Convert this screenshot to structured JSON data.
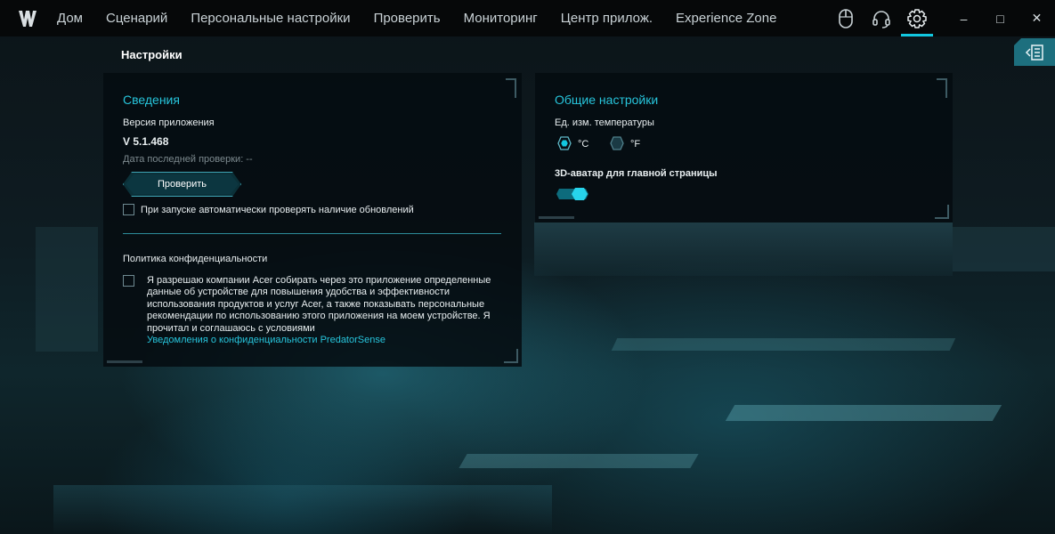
{
  "titlebar": {
    "nav": [
      "Дом",
      "Сценарий",
      "Персональные настройки",
      "Проверить",
      "Мониторинг",
      "Центр прилож.",
      "Experience Zone"
    ],
    "window_controls": {
      "minimize": "–",
      "maximize": "□",
      "close": "✕"
    }
  },
  "page": {
    "title": "Настройки"
  },
  "info": {
    "title": "Сведения",
    "version_label": "Версия приложения",
    "version_value": "V 5.1.468",
    "last_check": "Дата последней проверки: --",
    "check_button": "Проверить",
    "auto_check_label": "При запуске автоматически проверять наличие обновлений",
    "auto_check_checked": false,
    "privacy_title": "Политика конфиденциальности",
    "privacy_text": "Я разрешаю компании Acer собирать через это приложение определенные данные об устройстве для повышения удобства и эффективности использования продуктов и услуг Acer, а также показывать персональные рекомендации по использованию этого приложения на моем устройстве. Я прочитал и соглашаюсь с условиями",
    "privacy_link": "Уведомления о конфиденциальности PredatorSense",
    "privacy_checked": false
  },
  "general": {
    "title": "Общие настройки",
    "temp_label": "Ед. изм. температуры",
    "temp_options": [
      "°C",
      "°F"
    ],
    "temp_selected": "°C",
    "avatar_label": "3D-аватар для главной страницы",
    "avatar_enabled": true
  },
  "colors": {
    "accent": "#12c8e0",
    "title_accent": "#27c5dc"
  }
}
